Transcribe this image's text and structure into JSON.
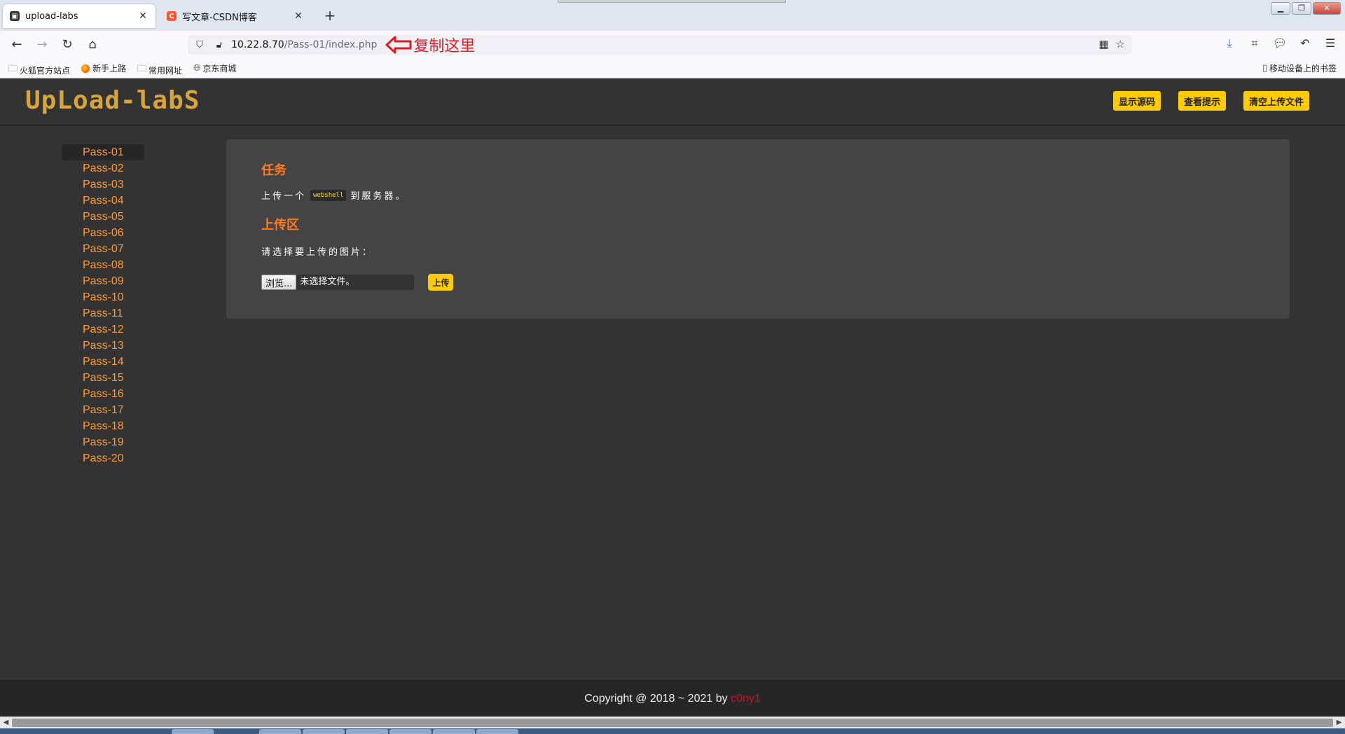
{
  "browser": {
    "tabs": [
      {
        "title": "upload-labs",
        "active": true
      },
      {
        "title": "写文章-CSDN博客",
        "active": false
      }
    ],
    "url": {
      "host": "10.22.8.70",
      "path": "/Pass-01/index.php"
    },
    "annotation": "复制这里",
    "bookmarks": [
      "火狐官方站点",
      "新手上路",
      "常用网址",
      "京东商城"
    ],
    "mobile_bookmarks": "移动设备上的书签"
  },
  "header": {
    "logo": "UpLoad-labS",
    "buttons": {
      "show_source": "显示源码",
      "view_hint": "查看提示",
      "clear_uploads": "清空上传文件"
    }
  },
  "sidebar": {
    "items": [
      "Pass-01",
      "Pass-02",
      "Pass-03",
      "Pass-04",
      "Pass-05",
      "Pass-06",
      "Pass-07",
      "Pass-08",
      "Pass-09",
      "Pass-10",
      "Pass-11",
      "Pass-12",
      "Pass-13",
      "Pass-14",
      "Pass-15",
      "Pass-16",
      "Pass-17",
      "Pass-18",
      "Pass-19",
      "Pass-20"
    ],
    "active": "Pass-01"
  },
  "task": {
    "title": "任务",
    "text_before": "上传一个",
    "code": "webshell",
    "text_after": "到服务器。"
  },
  "upload": {
    "title": "上传区",
    "prompt": "请选择要上传的图片：",
    "browse_label": "浏览...",
    "no_file": "未选择文件。",
    "submit_label": "上传"
  },
  "footer": {
    "copyright": "Copyright @ 2018 ~ 2021 by ",
    "author": "c0ny1"
  },
  "colors": {
    "accent": "#ffcc00",
    "orange": "#ff7a1a",
    "link": "#ff9a33",
    "author": "#d0102a"
  }
}
